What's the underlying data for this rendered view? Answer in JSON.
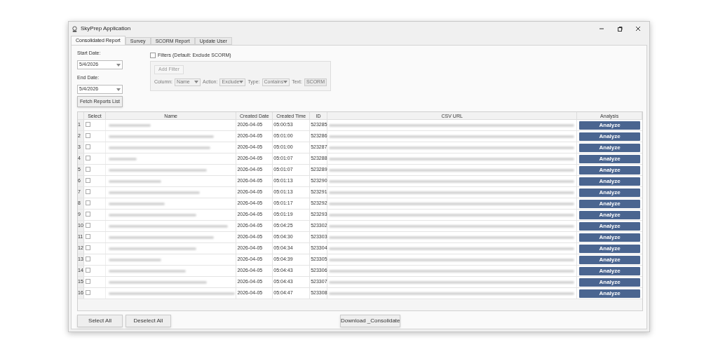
{
  "window": {
    "title": "SkyPrep Application"
  },
  "tabs": [
    {
      "label": "Consolidated Report",
      "selected": true
    },
    {
      "label": "Survey",
      "selected": false
    },
    {
      "label": "SCORM Report",
      "selected": false
    },
    {
      "label": "Update User",
      "selected": false
    }
  ],
  "dates": [
    {
      "label": "Start Date:",
      "value": "5/4/2026"
    },
    {
      "label": "End Date:",
      "value": "5/4/2026"
    }
  ],
  "fetch_button": "Fetch Reports List",
  "filters": {
    "label": "Filters (Default: Exclude SCORM)",
    "checked": false,
    "disabled": true,
    "add_button": "Add Filter",
    "fields": [
      {
        "label": "Column:",
        "value": "Name",
        "kind": "select"
      },
      {
        "label": "Action:",
        "value": "Exclude",
        "kind": "select"
      },
      {
        "label": "Type:",
        "value": "Contains",
        "kind": "select"
      },
      {
        "label": "Text:",
        "value": "SCORM",
        "kind": "text"
      }
    ]
  },
  "table": {
    "columns": [
      "Select",
      "Name",
      "Created Date",
      "Created Time",
      "ID",
      "CSV URL",
      "Analysis"
    ],
    "rows": [
      {
        "number": "1",
        "checked": false,
        "created_date": "2026-04-05",
        "created_time": "05:00:53",
        "id": "523285",
        "action": "Analyze"
      },
      {
        "number": "2",
        "checked": false,
        "created_date": "2026-04-05",
        "created_time": "05:01:00",
        "id": "523286",
        "action": "Analyze"
      },
      {
        "number": "3",
        "checked": false,
        "created_date": "2026-04-05",
        "created_time": "05:01:00",
        "id": "523287",
        "action": "Analyze"
      },
      {
        "number": "4",
        "checked": false,
        "created_date": "2026-04-05",
        "created_time": "05:01:07",
        "id": "523288",
        "action": "Analyze"
      },
      {
        "number": "5",
        "checked": false,
        "created_date": "2026-04-05",
        "created_time": "05:01:07",
        "id": "523289",
        "action": "Analyze"
      },
      {
        "number": "6",
        "checked": false,
        "created_date": "2026-04-05",
        "created_time": "05:01:13",
        "id": "523290",
        "action": "Analyze"
      },
      {
        "number": "7",
        "checked": false,
        "created_date": "2026-04-05",
        "created_time": "05:01:13",
        "id": "523291",
        "action": "Analyze"
      },
      {
        "number": "8",
        "checked": false,
        "created_date": "2026-04-05",
        "created_time": "05:01:17",
        "id": "523292",
        "action": "Analyze"
      },
      {
        "number": "9",
        "checked": false,
        "created_date": "2026-04-05",
        "created_time": "05:01:19",
        "id": "523293",
        "action": "Analyze"
      },
      {
        "number": "10",
        "checked": false,
        "created_date": "2026-04-05",
        "created_time": "05:04:25",
        "id": "523302",
        "action": "Analyze"
      },
      {
        "number": "11",
        "checked": false,
        "created_date": "2026-04-05",
        "created_time": "05:04:30",
        "id": "523303",
        "action": "Analyze"
      },
      {
        "number": "12",
        "checked": false,
        "created_date": "2026-04-05",
        "created_time": "05:04:34",
        "id": "523304",
        "action": "Analyze"
      },
      {
        "number": "13",
        "checked": false,
        "created_date": "2026-04-05",
        "created_time": "05:04:39",
        "id": "523305",
        "action": "Analyze"
      },
      {
        "number": "14",
        "checked": false,
        "created_date": "2026-04-05",
        "created_time": "05:04:43",
        "id": "523306",
        "action": "Analyze"
      },
      {
        "number": "15",
        "checked": false,
        "created_date": "2026-04-05",
        "created_time": "05:04:43",
        "id": "523307",
        "action": "Analyze"
      },
      {
        "number": "16",
        "checked": false,
        "created_date": "2026-04-05",
        "created_time": "05:04:47",
        "id": "523308",
        "action": "Analyze"
      }
    ]
  },
  "bottom_buttons": [
    "Select All",
    "Deselect All",
    "Download _Consolidate"
  ]
}
